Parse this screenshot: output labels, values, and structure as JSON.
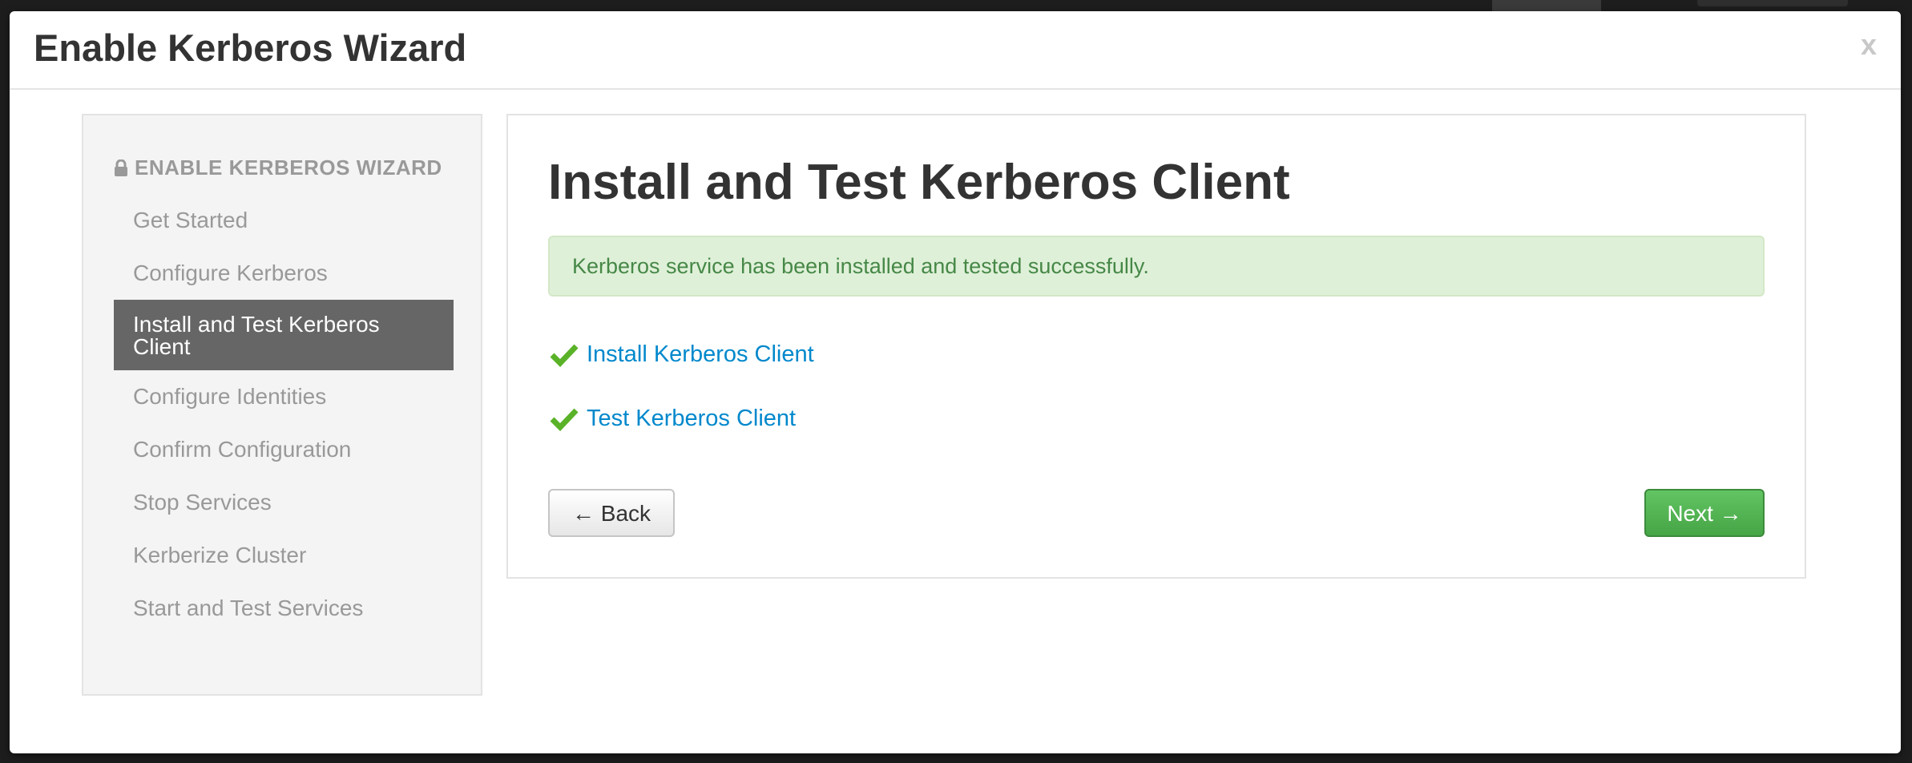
{
  "modal": {
    "title": "Enable Kerberos Wizard",
    "close_label": "x"
  },
  "sidebar": {
    "header": "ENABLE KERBEROS WIZARD",
    "header_icon": "lock-icon",
    "steps": [
      {
        "label": "Get Started",
        "state": "inactive"
      },
      {
        "label": "Configure Kerberos",
        "state": "inactive"
      },
      {
        "label": "Install and Test Kerberos Client",
        "state": "active"
      },
      {
        "label": "Configure Identities",
        "state": "inactive"
      },
      {
        "label": "Confirm Configuration",
        "state": "inactive"
      },
      {
        "label": "Stop Services",
        "state": "inactive"
      },
      {
        "label": "Kerberize Cluster",
        "state": "inactive"
      },
      {
        "label": "Start and Test Services",
        "state": "inactive"
      }
    ]
  },
  "content": {
    "title": "Install and Test Kerberos Client",
    "alert": "Kerberos service has been installed and tested successfully.",
    "tasks": [
      {
        "label": "Install Kerberos Client",
        "status": "success",
        "icon": "check-icon"
      },
      {
        "label": "Test Kerberos Client",
        "status": "success",
        "icon": "check-icon"
      }
    ],
    "back_label": "← Back",
    "next_label": "Next →"
  },
  "colors": {
    "check_green": "#5ab228",
    "link_blue": "#0088cc",
    "alert_bg": "#dff0d8",
    "alert_text": "#468847",
    "active_step_bg": "#666666",
    "next_button": "#51a351"
  }
}
